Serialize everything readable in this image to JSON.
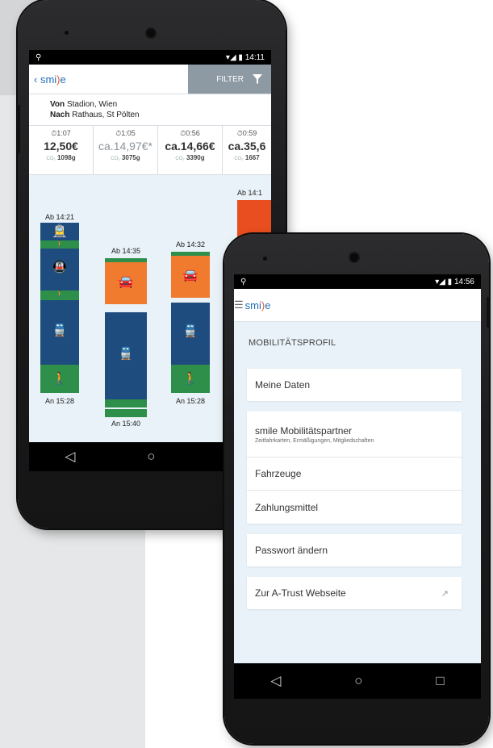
{
  "phone1": {
    "status_time": "14:11",
    "app": {
      "logo_prefix": "smi",
      "logo_mid": ")",
      "logo_suffix": "e",
      "filter_label": "FILTER"
    },
    "route": {
      "from_label": "Von",
      "from_value": "Stadion, Wien",
      "to_label": "Nach",
      "to_value": "Rathaus, St Pölten"
    },
    "options": [
      {
        "duration": "⏱1:07",
        "price": "12,50€",
        "co2_label": "CO₂",
        "co2": "1098g"
      },
      {
        "duration": "⏱1:05",
        "price": "ca.14,97€*",
        "co2_label": "CO₂",
        "co2": "3075g"
      },
      {
        "duration": "⏱0:56",
        "price": "ca.14,66€",
        "co2_label": "CO₂",
        "co2": "3390g"
      },
      {
        "duration": "⏱0:59",
        "price": "ca.35,6",
        "co2_label": "CO₂",
        "co2": "1667"
      }
    ],
    "timeline": [
      {
        "depart": "Ab 14:21",
        "arrive": "An 15:28"
      },
      {
        "depart": "Ab 14:35",
        "arrive": "An 15:40"
      },
      {
        "depart": "Ab 14:32",
        "arrive": "An 15:28"
      },
      {
        "depart": "Ab 14:1"
      }
    ]
  },
  "phone2": {
    "status_time": "14:56",
    "app": {
      "logo_prefix": "smi",
      "logo_mid": ")",
      "logo_suffix": "e"
    },
    "section_title": "MOBILITÄTSPROFIL",
    "items": {
      "meine_daten": "Meine Daten",
      "partner": "smile Mobilitätspartner",
      "partner_sub": "Zeitfahrkarten, Ermäßigungen, Mitgliedschaften",
      "fahrzeuge": "Fahrzeuge",
      "zahlungsmittel": "Zahlungsmittel",
      "passwort": "Passwort ändern",
      "atrust": "Zur A-Trust Webseite"
    }
  },
  "nav": {
    "back": "◁",
    "home": "○",
    "recent": "□"
  },
  "colors": {
    "public_transport": "#1f4c7e",
    "walk": "#2e8f4a",
    "car": "#f07b2e",
    "accent": "#e84e1f",
    "brand": "#1e6fb8"
  },
  "icons": [
    "tram-icon",
    "train-icon",
    "walk-icon",
    "car-icon",
    "filter-icon",
    "back-chevron-icon",
    "menu-icon",
    "external-link-icon"
  ]
}
